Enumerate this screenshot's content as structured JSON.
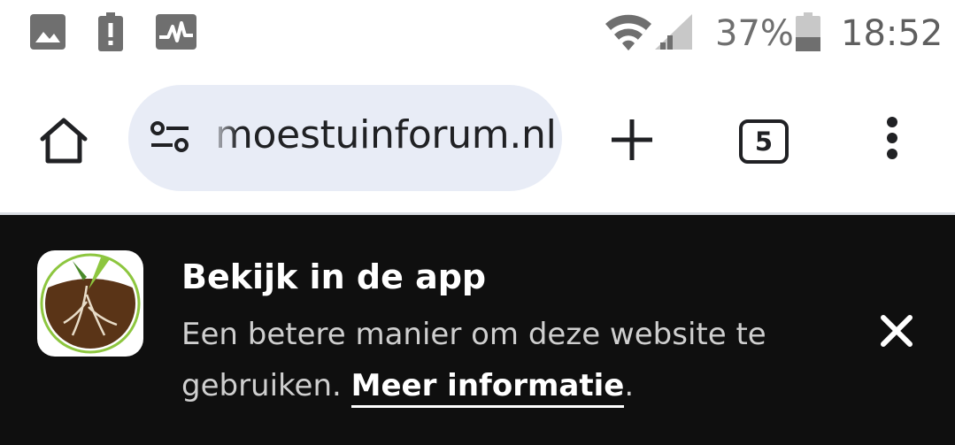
{
  "status_bar": {
    "battery_percent": "37%",
    "time": "18:52",
    "icons": [
      "image-notification-icon",
      "battery-alert-icon",
      "activity-icon",
      "wifi-icon",
      "cell-signal-icon",
      "battery-icon"
    ]
  },
  "toolbar": {
    "url": "moestuinforum.nl",
    "tab_count": "5",
    "icons": [
      "home-icon",
      "site-settings-icon",
      "new-tab-icon",
      "menu-icon"
    ]
  },
  "app_banner": {
    "title": "Bekijk in de app",
    "description": "Een betere manier om deze website te gebruiken.",
    "link_label": "Meer informatie",
    "suffix": ".",
    "close_icon": "close-icon",
    "colors": {
      "background": "#0f0f0f",
      "logo_brown": "#5a3417",
      "logo_green": "#8dc63f"
    }
  }
}
